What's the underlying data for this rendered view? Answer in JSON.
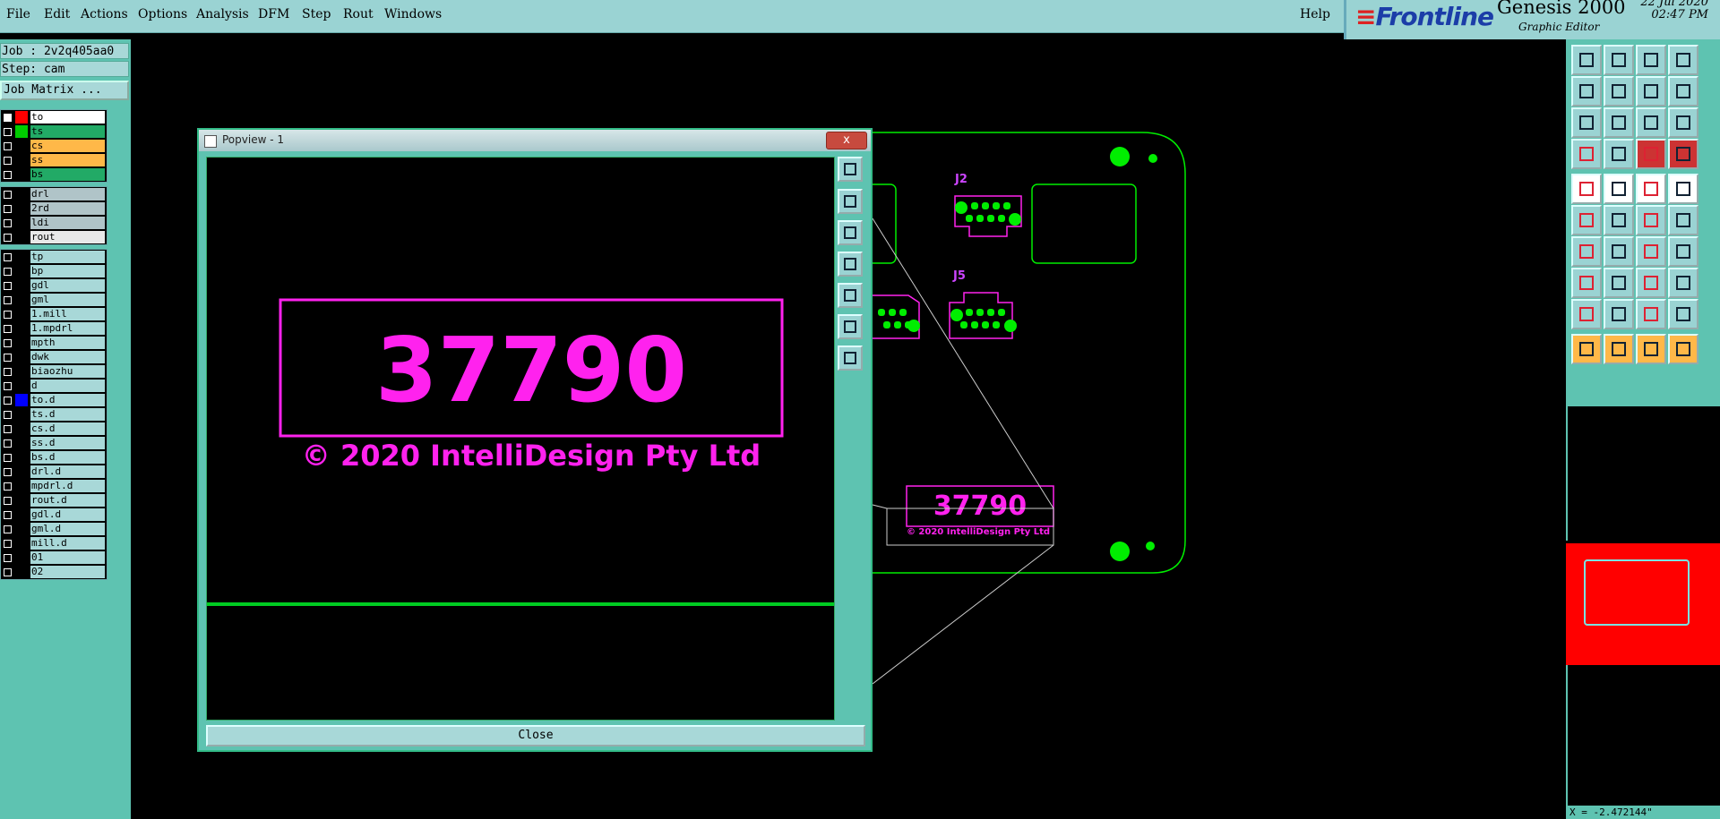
{
  "menu": {
    "items": [
      "File",
      "Edit",
      "Actions",
      "Options",
      "Analysis",
      "DFM",
      "Step",
      "Rout",
      "Windows"
    ],
    "help": "Help"
  },
  "brand": {
    "logo": "Frontline",
    "product": "Genesis 2000",
    "subtitle": "Graphic Editor",
    "date": "22 Jul 2020",
    "time": "02:47 PM"
  },
  "job": {
    "job_label": "Job : 2v2q405aa0",
    "step_label": "Step: cam",
    "matrix_button": "Job Matrix ..."
  },
  "layers": {
    "group1": [
      {
        "name": "to",
        "swatch": "#ff0000",
        "bg": "#ffffff",
        "active": true
      },
      {
        "name": "ts",
        "swatch": "#00cc00",
        "bg": "#22aa66"
      },
      {
        "name": "cs",
        "swatch": "#000000",
        "bg": "#ffb848"
      },
      {
        "name": "ss",
        "swatch": "#000000",
        "bg": "#ffb848"
      },
      {
        "name": "bs",
        "swatch": "#000000",
        "bg": "#22aa66"
      }
    ],
    "group2": [
      {
        "name": "drl",
        "bg": "#b0c4c8"
      },
      {
        "name": "2rd",
        "bg": "#b0c4c8"
      },
      {
        "name": "ldi",
        "bg": "#b0c4c8"
      },
      {
        "name": "rout",
        "bg": "#e8e8e8"
      }
    ],
    "group3": [
      {
        "name": "tp"
      },
      {
        "name": "bp"
      },
      {
        "name": "gdl"
      },
      {
        "name": "gml"
      },
      {
        "name": "1.mill"
      },
      {
        "name": "1.mpdrl"
      },
      {
        "name": "mpth"
      },
      {
        "name": "dwk"
      },
      {
        "name": "biaozhu"
      },
      {
        "name": "d"
      },
      {
        "name": "to.d",
        "swatch": "#0000ff"
      },
      {
        "name": "ts.d"
      },
      {
        "name": "cs.d"
      },
      {
        "name": "ss.d"
      },
      {
        "name": "bs.d"
      },
      {
        "name": "drl.d"
      },
      {
        "name": "mpdrl.d"
      },
      {
        "name": "rout.d"
      },
      {
        "name": "gdl.d"
      },
      {
        "name": "gml.d"
      },
      {
        "name": "mill.d"
      },
      {
        "name": "01"
      },
      {
        "name": "02"
      }
    ]
  },
  "popview": {
    "title": "Popview - 1",
    "close_x": "x",
    "big_text": "37790",
    "copyright": "© 2020 IntelliDesign Pty Ltd",
    "close_button": "Close"
  },
  "board": {
    "j2_label": "J2",
    "j5_label": "J5",
    "small_text": "37790",
    "small_copyright": "© 2020 IntelliDesign Pty Ltd"
  },
  "status": {
    "coords": "X = -2.472144\""
  },
  "colors": {
    "panel": "#5ec3b1",
    "menubar": "#9ad3d3",
    "magenta": "#ff22ee",
    "green": "#00ee00",
    "overview_red": "#ff0000"
  }
}
